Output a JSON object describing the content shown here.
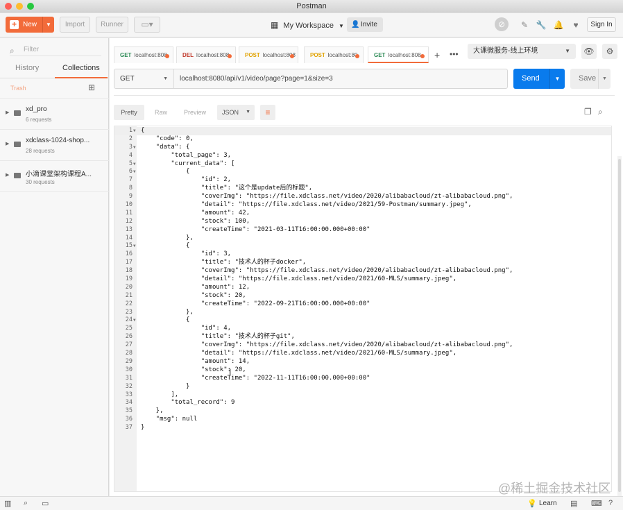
{
  "window": {
    "title": "Postman"
  },
  "toolbar": {
    "new_label": "New",
    "import_label": "Import",
    "runner_label": "Runner",
    "workspace_label": "My Workspace",
    "invite_label": "Invite",
    "signin_label": "Sign In"
  },
  "sidebar": {
    "filter_placeholder": "Filter",
    "tabs": [
      {
        "label": "History"
      },
      {
        "label": "Collections"
      }
    ],
    "trash_label": "Trash",
    "collections": [
      {
        "name": "xd_pro",
        "count": "6 requests"
      },
      {
        "name": "xdclass-1024-shop...",
        "count": "28 requests"
      },
      {
        "name": "小滴课堂架构课程A...",
        "count": "30 requests"
      }
    ]
  },
  "request_tabs": [
    {
      "method": "GET",
      "url": "localhost:808",
      "method_color": "#2e8b57"
    },
    {
      "method": "DEL",
      "url": "localhost:808",
      "method_color": "#c0392b"
    },
    {
      "method": "POST",
      "url": "localhost:808",
      "method_color": "#e1a200"
    },
    {
      "method": "POST",
      "url": "localhost:80",
      "method_color": "#e1a200"
    },
    {
      "method": "GET",
      "url": "localhost:808",
      "method_color": "#2e8b57"
    }
  ],
  "environment": {
    "label": "大课微服务-线上环境"
  },
  "request": {
    "method": "GET",
    "url": "localhost:8080/api/v1/video/page?page=1&size=3",
    "send_label": "Send",
    "save_label": "Save"
  },
  "response_view": {
    "modes": [
      "Pretty",
      "Raw",
      "Preview"
    ],
    "active_mode": "Pretty",
    "format": "JSON"
  },
  "response_lines": [
    {
      "n": "1",
      "fold": true,
      "text": "{"
    },
    {
      "n": "2",
      "fold": false,
      "text": "    \"code\": 0,"
    },
    {
      "n": "3",
      "fold": true,
      "text": "    \"data\": {"
    },
    {
      "n": "4",
      "fold": false,
      "text": "        \"total_page\": 3,"
    },
    {
      "n": "5",
      "fold": true,
      "text": "        \"current_data\": ["
    },
    {
      "n": "6",
      "fold": true,
      "text": "            {"
    },
    {
      "n": "7",
      "fold": false,
      "text": "                \"id\": 2,"
    },
    {
      "n": "8",
      "fold": false,
      "text": "                \"title\": \"这个是update后的标题\","
    },
    {
      "n": "9",
      "fold": false,
      "text": "                \"coverImg\": \"https://file.xdclass.net/video/2020/alibabacloud/zt-alibabacloud.png\","
    },
    {
      "n": "10",
      "fold": false,
      "text": "                \"detail\": \"https://file.xdclass.net/video/2021/59-Postman/summary.jpeg\","
    },
    {
      "n": "11",
      "fold": false,
      "text": "                \"amount\": 42,"
    },
    {
      "n": "12",
      "fold": false,
      "text": "                \"stock\": 100,"
    },
    {
      "n": "13",
      "fold": false,
      "text": "                \"createTime\": \"2021-03-11T16:00:00.000+00:00\""
    },
    {
      "n": "14",
      "fold": false,
      "text": "            },"
    },
    {
      "n": "15",
      "fold": true,
      "text": "            {"
    },
    {
      "n": "16",
      "fold": false,
      "text": "                \"id\": 3,"
    },
    {
      "n": "17",
      "fold": false,
      "text": "                \"title\": \"技术人的杯子docker\","
    },
    {
      "n": "18",
      "fold": false,
      "text": "                \"coverImg\": \"https://file.xdclass.net/video/2020/alibabacloud/zt-alibabacloud.png\","
    },
    {
      "n": "19",
      "fold": false,
      "text": "                \"detail\": \"https://file.xdclass.net/video/2021/60-MLS/summary.jpeg\","
    },
    {
      "n": "20",
      "fold": false,
      "text": "                \"amount\": 12,"
    },
    {
      "n": "21",
      "fold": false,
      "text": "                \"stock\": 20,"
    },
    {
      "n": "22",
      "fold": false,
      "text": "                \"createTime\": \"2022-09-21T16:00:00.000+00:00\""
    },
    {
      "n": "23",
      "fold": false,
      "text": "            },"
    },
    {
      "n": "24",
      "fold": true,
      "text": "            {"
    },
    {
      "n": "25",
      "fold": false,
      "text": "                \"id\": 4,"
    },
    {
      "n": "26",
      "fold": false,
      "text": "                \"title\": \"技术人的杯子git\","
    },
    {
      "n": "27",
      "fold": false,
      "text": "                \"coverImg\": \"https://file.xdclass.net/video/2020/alibabacloud/zt-alibabacloud.png\","
    },
    {
      "n": "28",
      "fold": false,
      "text": "                \"detail\": \"https://file.xdclass.net/video/2021/60-MLS/summary.jpeg\","
    },
    {
      "n": "29",
      "fold": false,
      "text": "                \"amount\": 14,"
    },
    {
      "n": "30",
      "fold": false,
      "text": "                \"stock\": 20,"
    },
    {
      "n": "31",
      "fold": false,
      "text": "                \"createTime\": \"2022-11-11T16:00:00.000+00:00\""
    },
    {
      "n": "32",
      "fold": false,
      "text": "            }"
    },
    {
      "n": "33",
      "fold": false,
      "text": "        ],"
    },
    {
      "n": "34",
      "fold": false,
      "text": "        \"total_record\": 9"
    },
    {
      "n": "35",
      "fold": false,
      "text": "    },"
    },
    {
      "n": "36",
      "fold": false,
      "text": "    \"msg\": null"
    },
    {
      "n": "37",
      "fold": false,
      "text": "}"
    }
  ],
  "statusbar": {
    "learn_label": "Learn"
  },
  "watermark": {
    "text": "@稀土掘金技术社区"
  },
  "colors": {
    "accent": "#f26b3a",
    "send": "#097bed"
  }
}
